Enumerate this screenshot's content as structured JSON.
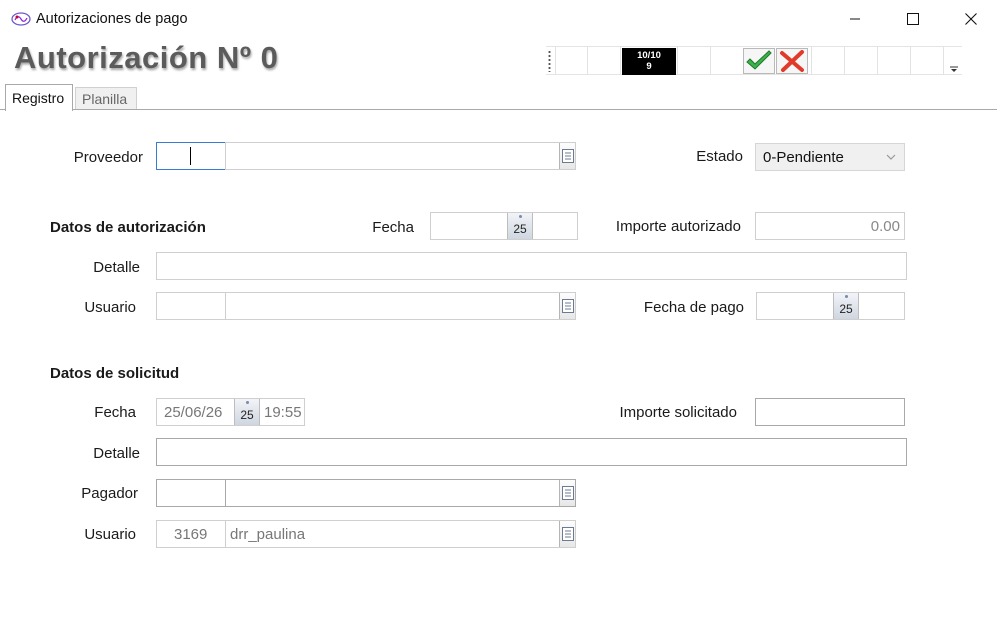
{
  "window": {
    "title": "Autorizaciones de pago"
  },
  "header": {
    "title": "Autorización Nº 0"
  },
  "toolbar": {
    "record_counter_line1": "10/10",
    "record_counter_line2": "9"
  },
  "tabs": [
    {
      "label": "Registro",
      "active": true
    },
    {
      "label": "Planilla",
      "active": false
    }
  ],
  "form": {
    "proveedor": {
      "label": "Proveedor",
      "code": "",
      "name": ""
    },
    "estado": {
      "label": "Estado",
      "value": "0-Pendiente"
    },
    "autorizacion": {
      "section_label": "Datos de autorización",
      "fecha_label": "Fecha",
      "fecha_value": "",
      "calendar_day": "25",
      "importe_label": "Importe autorizado",
      "importe_value": "0.00",
      "detalle_label": "Detalle",
      "detalle_value": "",
      "usuario_label": "Usuario",
      "usuario_code": "",
      "usuario_name": "",
      "fecha_pago_label": "Fecha de pago",
      "fecha_pago_value": "",
      "fecha_pago_calendar_day": "25"
    },
    "solicitud": {
      "section_label": "Datos de solicitud",
      "fecha_label": "Fecha",
      "fecha_date": "25/06/26",
      "calendar_day": "25",
      "fecha_time": "19:55",
      "importe_label": "Importe solicitado",
      "importe_value": "",
      "detalle_label": "Detalle",
      "detalle_value": "",
      "pagador_label": "Pagador",
      "pagador_code": "",
      "pagador_name": "",
      "usuario_label": "Usuario",
      "usuario_code": "3169",
      "usuario_name": "drr_paulina"
    }
  },
  "colors": {
    "accept": "#3bb34a",
    "cancel": "#e03a2a",
    "focus_border": "#3a7bd5"
  }
}
